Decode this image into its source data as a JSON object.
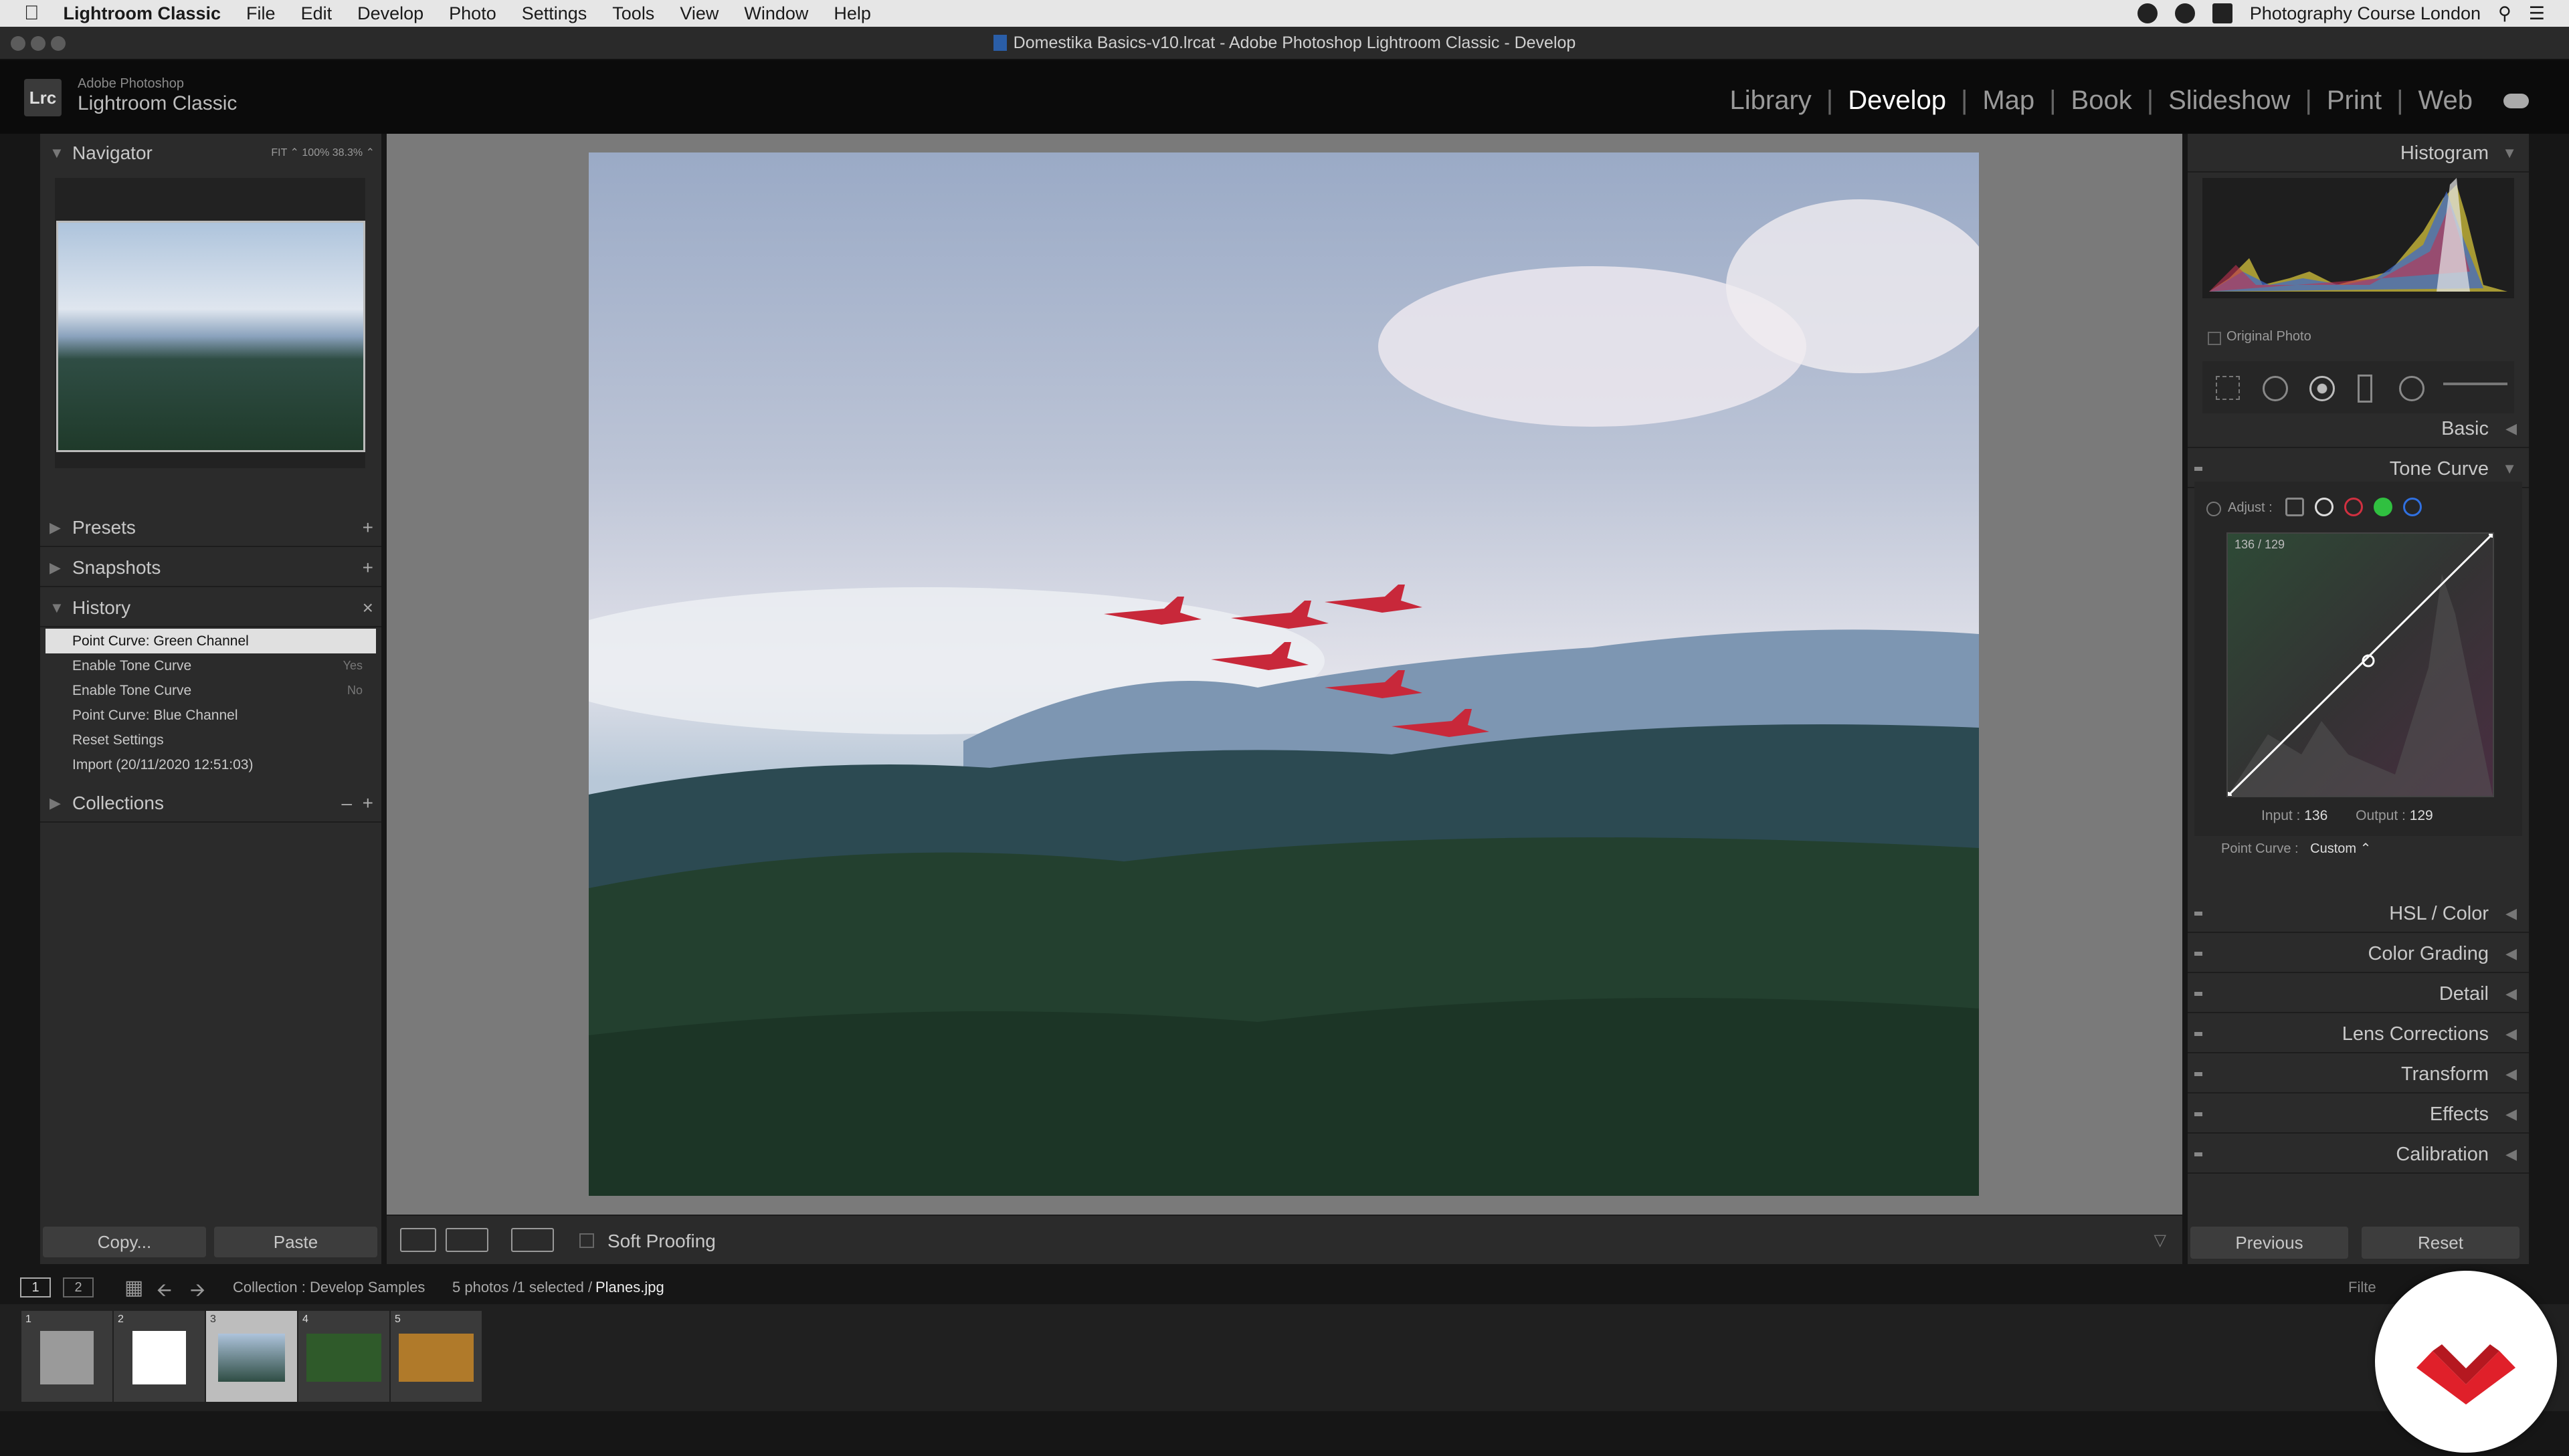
{
  "menubar": {
    "app": "Lightroom Classic",
    "items": [
      "File",
      "Edit",
      "Develop",
      "Photo",
      "Settings",
      "Tools",
      "View",
      "Window",
      "Help"
    ],
    "right_text": "Photography Course London"
  },
  "window": {
    "title": "Domestika Basics-v10.lrcat - Adobe Photoshop Lightroom Classic - Develop"
  },
  "identity": {
    "line1": "Adobe Photoshop",
    "line2": "Lightroom Classic",
    "badge": "Lrc"
  },
  "modules": [
    "Library",
    "Develop",
    "Map",
    "Book",
    "Slideshow",
    "Print",
    "Web"
  ],
  "active_module": "Develop",
  "left": {
    "navigator": {
      "title": "Navigator",
      "options": "FIT ⌃  100%  38.3% ⌃"
    },
    "presets": "Presets",
    "snapshots": "Snapshots",
    "history": {
      "title": "History",
      "items": [
        {
          "label": "Point Curve: Green Channel",
          "value": ""
        },
        {
          "label": "Enable Tone Curve",
          "value": "Yes"
        },
        {
          "label": "Enable Tone Curve",
          "value": "No"
        },
        {
          "label": "Point Curve: Blue Channel",
          "value": ""
        },
        {
          "label": "Reset Settings",
          "value": ""
        },
        {
          "label": "Import (20/11/2020 12:51:03)",
          "value": ""
        }
      ]
    },
    "collections": "Collections",
    "copy_label": "Copy...",
    "paste_label": "Paste"
  },
  "toolbar": {
    "soft_proofing": "Soft Proofing"
  },
  "right": {
    "histogram": "Histogram",
    "original_photo": "Original Photo",
    "basic": "Basic",
    "tone_curve": {
      "title": "Tone Curve",
      "adjust": "Adjust :",
      "readout": "136 / 129",
      "input_label": "Input :",
      "input_value": "136",
      "output_label": "Output :",
      "output_value": "129",
      "point_curve_label": "Point Curve :",
      "point_curve_value": "Custom ⌃"
    },
    "panels": [
      "HSL / Color",
      "Color Grading",
      "Detail",
      "Lens Corrections",
      "Transform",
      "Effects",
      "Calibration"
    ],
    "previous_label": "Previous",
    "reset_label": "Reset"
  },
  "filmbar": {
    "pages": [
      "1",
      "2"
    ],
    "source": "Collection : Develop Samples",
    "count": "5 photos /1 selected /",
    "file": "Planes.jpg",
    "filter": "Filte"
  },
  "filmstrip": [
    {
      "n": "1",
      "color": "#9a9a9a"
    },
    {
      "n": "2",
      "color": "#ffffff"
    },
    {
      "n": "3",
      "color": "#6f8aa8"
    },
    {
      "n": "4",
      "color": "#2f5a2a"
    },
    {
      "n": "5",
      "color": "#b07a2a"
    }
  ],
  "colors": {
    "brand_red": "#e0202a",
    "selected_thumb": "#bdbdbd"
  }
}
